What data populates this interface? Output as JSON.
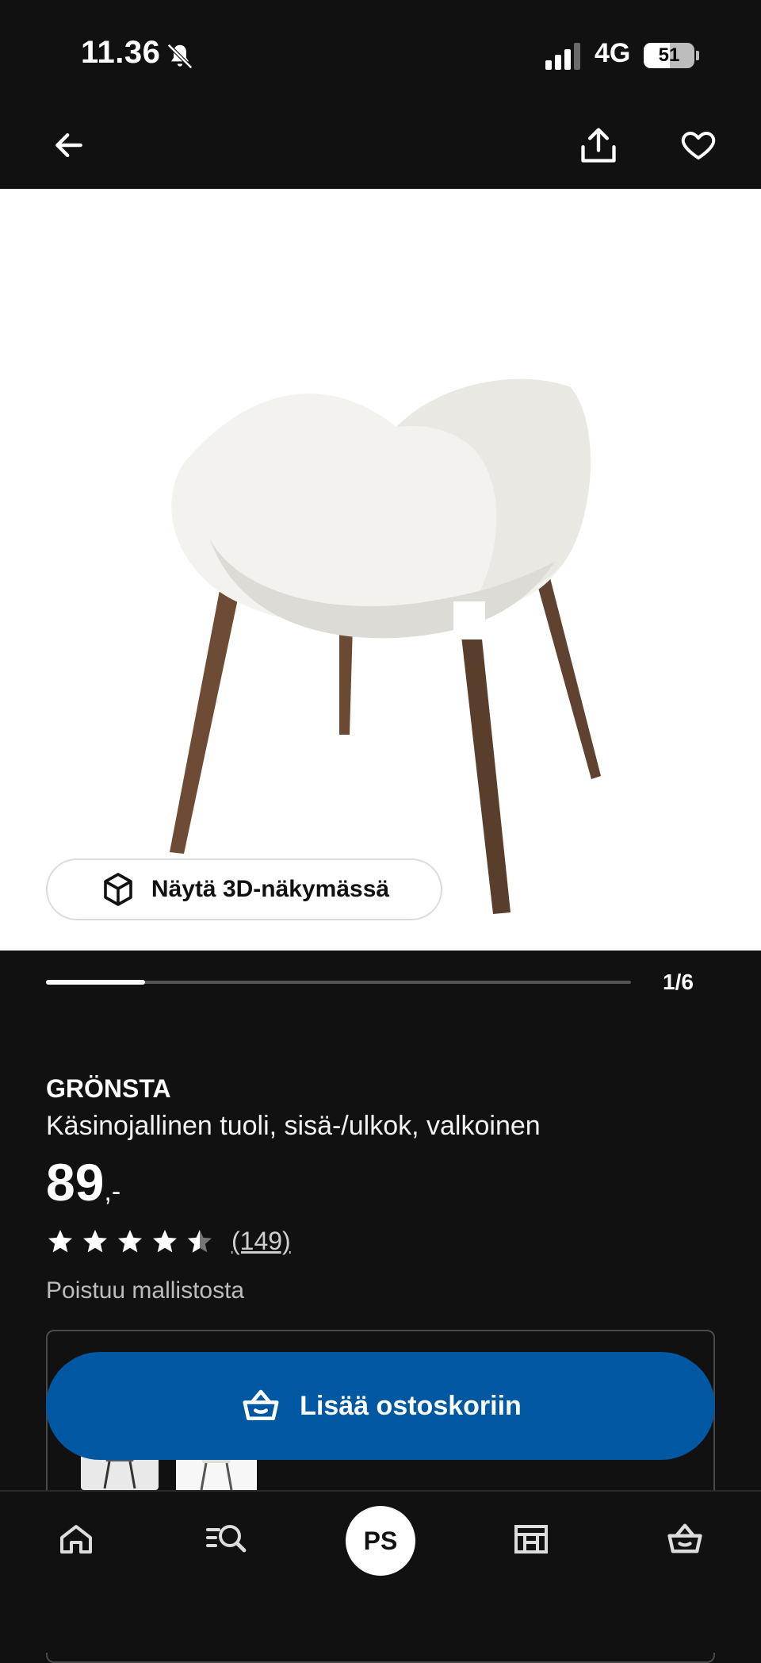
{
  "status_bar": {
    "time": "11.36",
    "network": "4G",
    "battery": "51"
  },
  "product": {
    "name": "GRÖNSTA",
    "description": "Käsinojallinen tuoli, sisä-/ulkok, valkoinen",
    "price": "89",
    "price_suffix": ",-",
    "rating_value": 4.5,
    "rating_max": 5,
    "review_count": "(149)",
    "availability_note": "Poistuu mallistosta"
  },
  "gallery": {
    "position_label": "1/6",
    "view_3d_label": "Näytä 3D-näkymässä",
    "progress": 0.17
  },
  "actions": {
    "add_to_cart_label": "Lisää ostoskoriin"
  },
  "bottom_nav": {
    "avatar_initials": "PS"
  },
  "colors": {
    "cart_button": "#0058a3",
    "background": "#111111"
  }
}
